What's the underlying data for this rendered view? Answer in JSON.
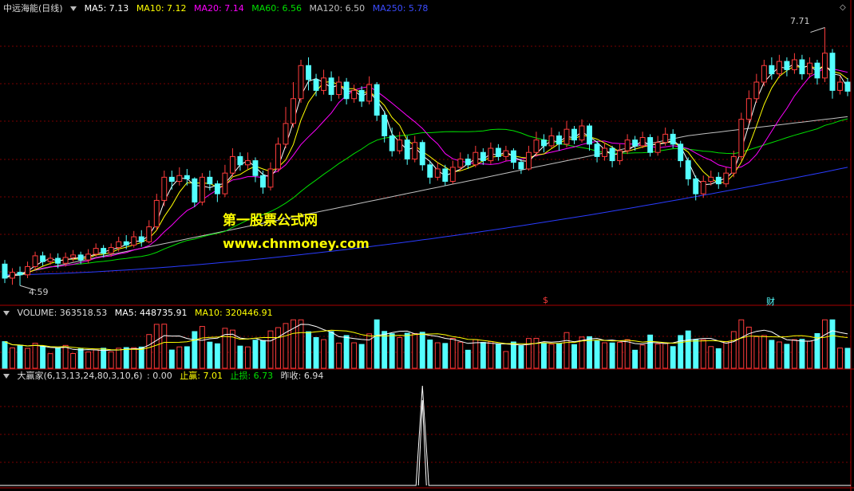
{
  "price_header": {
    "title": "中远海能(日线)",
    "ma5": "MA5: 7.13",
    "ma10": "MA10: 7.12",
    "ma20": "MA20: 7.14",
    "ma60": "MA60: 6.56",
    "ma120": "MA120: 6.50",
    "ma250": "MA250: 5.78"
  },
  "volume_header": {
    "volume": "VOLUME: 363518.53",
    "ma5": "MA5: 448735.91",
    "ma10": "MA10: 320446.91"
  },
  "indicator_header": {
    "name": "大赢家(6,13,13,24,80,3,10,6)",
    "value": ": 0.00",
    "take_profit": "止赢: 7.01",
    "stop_loss": "止损: 6.73",
    "prev_close": "昨收: 6.94"
  },
  "watermark": {
    "line1": "第一股票公式网",
    "line2": "www.chnmoney.com"
  },
  "annotations": {
    "high_label": "7.71",
    "low_label": "4.59",
    "marker_s": "$",
    "marker_cai": "财"
  },
  "colors": {
    "up": "#ff3c3c",
    "down": "#54ffff",
    "ma5": "#ffffff",
    "ma10": "#ffff00",
    "ma20": "#ff00ff",
    "ma60": "#00e000",
    "ma120": "#c0c0c0",
    "ma250": "#2a3cff",
    "grid": "#7a0000",
    "divider": "#aa0000"
  },
  "chart_data": {
    "type": "candlestick",
    "price_range": [
      4.4,
      7.85
    ],
    "high": 7.71,
    "low": 4.59,
    "candles": [
      [
        4.85,
        4.68,
        4.9,
        4.62
      ],
      [
        4.68,
        4.75,
        4.8,
        4.6
      ],
      [
        4.75,
        4.72,
        4.82,
        4.59
      ],
      [
        4.72,
        4.82,
        4.88,
        4.68
      ],
      [
        4.82,
        4.95,
        5.0,
        4.78
      ],
      [
        4.95,
        4.88,
        5.0,
        4.83
      ],
      [
        4.88,
        4.92,
        4.98,
        4.84
      ],
      [
        4.92,
        4.86,
        4.98,
        4.8
      ],
      [
        4.86,
        4.93,
        4.99,
        4.82
      ],
      [
        4.93,
        4.96,
        5.02,
        4.88
      ],
      [
        4.96,
        4.9,
        5.0,
        4.85
      ],
      [
        4.9,
        4.97,
        5.03,
        4.86
      ],
      [
        4.97,
        5.04,
        5.1,
        4.94
      ],
      [
        5.04,
        4.98,
        5.08,
        4.93
      ],
      [
        4.98,
        5.05,
        5.1,
        4.94
      ],
      [
        5.05,
        5.12,
        5.18,
        5.0
      ],
      [
        5.12,
        5.08,
        5.2,
        5.03
      ],
      [
        5.08,
        5.18,
        5.25,
        5.05
      ],
      [
        5.18,
        5.12,
        5.26,
        5.06
      ],
      [
        5.12,
        5.3,
        5.38,
        5.1
      ],
      [
        5.3,
        5.62,
        5.7,
        5.26
      ],
      [
        5.62,
        5.9,
        5.98,
        5.55
      ],
      [
        5.9,
        5.85,
        5.98,
        5.75
      ],
      [
        5.85,
        5.92,
        6.02,
        5.8
      ],
      [
        5.92,
        5.88,
        6.0,
        5.8
      ],
      [
        5.88,
        5.6,
        5.9,
        5.54
      ],
      [
        5.6,
        5.9,
        5.95,
        5.56
      ],
      [
        5.9,
        5.82,
        5.98,
        5.74
      ],
      [
        5.82,
        5.7,
        5.86,
        5.6
      ],
      [
        5.7,
        5.95,
        6.05,
        5.66
      ],
      [
        5.95,
        6.15,
        6.25,
        5.9
      ],
      [
        6.15,
        6.05,
        6.2,
        5.98
      ],
      [
        6.05,
        6.1,
        6.2,
        6.0
      ],
      [
        6.1,
        5.92,
        6.14,
        5.84
      ],
      [
        5.92,
        5.78,
        5.98,
        5.7
      ],
      [
        5.78,
        6.0,
        6.08,
        5.74
      ],
      [
        6.0,
        6.3,
        6.38,
        5.96
      ],
      [
        6.3,
        6.55,
        6.75,
        6.25
      ],
      [
        6.55,
        6.85,
        7.05,
        6.5
      ],
      [
        6.85,
        7.25,
        7.32,
        6.8
      ],
      [
        7.25,
        7.08,
        7.35,
        6.95
      ],
      [
        7.08,
        6.95,
        7.15,
        6.88
      ],
      [
        6.95,
        7.1,
        7.2,
        6.9
      ],
      [
        7.1,
        6.9,
        7.18,
        6.82
      ],
      [
        6.9,
        7.05,
        7.12,
        6.85
      ],
      [
        7.05,
        6.85,
        7.1,
        6.78
      ],
      [
        6.85,
        6.95,
        7.02,
        6.8
      ],
      [
        6.95,
        6.82,
        7.0,
        6.75
      ],
      [
        6.82,
        7.02,
        7.12,
        6.78
      ],
      [
        7.02,
        6.65,
        7.05,
        6.58
      ],
      [
        6.65,
        6.4,
        6.7,
        6.32
      ],
      [
        6.4,
        6.22,
        6.5,
        6.15
      ],
      [
        6.22,
        6.35,
        6.45,
        6.18
      ],
      [
        6.35,
        6.12,
        6.4,
        6.05
      ],
      [
        6.12,
        6.32,
        6.4,
        6.08
      ],
      [
        6.32,
        6.05,
        6.35,
        5.98
      ],
      [
        6.05,
        5.9,
        6.1,
        5.82
      ],
      [
        5.9,
        6.0,
        6.08,
        5.86
      ],
      [
        6.0,
        5.85,
        6.05,
        5.8
      ],
      [
        5.85,
        6.02,
        6.1,
        5.82
      ],
      [
        6.02,
        6.12,
        6.2,
        5.98
      ],
      [
        6.12,
        6.05,
        6.18,
        6.0
      ],
      [
        6.05,
        6.2,
        6.28,
        6.02
      ],
      [
        6.2,
        6.1,
        6.25,
        6.05
      ],
      [
        6.1,
        6.25,
        6.32,
        6.06
      ],
      [
        6.25,
        6.15,
        6.3,
        6.1
      ],
      [
        6.15,
        6.22,
        6.28,
        6.1
      ],
      [
        6.22,
        6.08,
        6.25,
        6.0
      ],
      [
        6.08,
        6.0,
        6.12,
        5.94
      ],
      [
        6.0,
        6.2,
        6.28,
        5.98
      ],
      [
        6.2,
        6.35,
        6.45,
        6.15
      ],
      [
        6.35,
        6.28,
        6.42,
        6.2
      ],
      [
        6.28,
        6.4,
        6.5,
        6.25
      ],
      [
        6.4,
        6.3,
        6.45,
        6.22
      ],
      [
        6.3,
        6.48,
        6.58,
        6.26
      ],
      [
        6.48,
        6.35,
        6.52,
        6.3
      ],
      [
        6.35,
        6.52,
        6.6,
        6.32
      ],
      [
        6.52,
        6.3,
        6.55,
        6.22
      ],
      [
        6.3,
        6.15,
        6.34,
        6.08
      ],
      [
        6.15,
        6.25,
        6.32,
        6.1
      ],
      [
        6.25,
        6.1,
        6.28,
        6.02
      ],
      [
        6.1,
        6.22,
        6.3,
        6.05
      ],
      [
        6.22,
        6.35,
        6.42,
        6.18
      ],
      [
        6.35,
        6.28,
        6.4,
        6.22
      ],
      [
        6.28,
        6.38,
        6.45,
        6.25
      ],
      [
        6.38,
        6.2,
        6.42,
        6.15
      ],
      [
        6.2,
        6.32,
        6.4,
        6.16
      ],
      [
        6.32,
        6.42,
        6.5,
        6.28
      ],
      [
        6.42,
        6.3,
        6.48,
        6.25
      ],
      [
        6.3,
        6.1,
        6.34,
        6.02
      ],
      [
        6.1,
        5.88,
        6.14,
        5.8
      ],
      [
        5.88,
        5.7,
        5.92,
        5.62
      ],
      [
        5.7,
        5.85,
        5.92,
        5.65
      ],
      [
        5.85,
        5.9,
        5.98,
        5.8
      ],
      [
        5.9,
        5.82,
        5.96,
        5.76
      ],
      [
        5.82,
        5.95,
        6.02,
        5.78
      ],
      [
        5.95,
        6.15,
        6.22,
        5.9
      ],
      [
        6.15,
        6.6,
        6.68,
        6.1
      ],
      [
        6.6,
        6.85,
        6.95,
        6.55
      ],
      [
        6.85,
        7.05,
        7.15,
        6.8
      ],
      [
        7.05,
        7.25,
        7.32,
        7.0
      ],
      [
        7.25,
        7.15,
        7.35,
        7.08
      ],
      [
        7.15,
        7.3,
        7.38,
        7.1
      ],
      [
        7.3,
        7.2,
        7.35,
        7.12
      ],
      [
        7.2,
        7.32,
        7.4,
        7.15
      ],
      [
        7.32,
        7.15,
        7.38,
        7.08
      ],
      [
        7.15,
        7.28,
        7.35,
        7.1
      ],
      [
        7.28,
        7.1,
        7.32,
        7.02
      ],
      [
        7.1,
        7.4,
        7.71,
        7.05
      ],
      [
        7.4,
        6.95,
        7.45,
        6.85
      ],
      [
        6.95,
        7.05,
        7.12,
        6.9
      ],
      [
        7.05,
        6.94,
        7.1,
        6.88
      ]
    ],
    "volume_range": [
      0,
      900000
    ],
    "volume_last": 363518.53,
    "volume_ma5_last": 448735.91,
    "volume_ma10_last": 320446.91,
    "indicator_peak_index": 55,
    "indicator_last": 0.0
  }
}
